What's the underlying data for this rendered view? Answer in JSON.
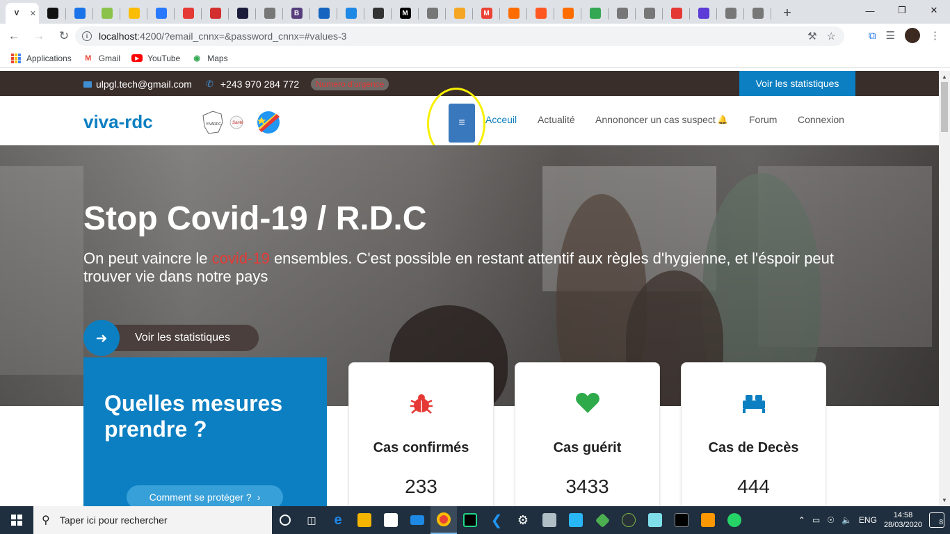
{
  "browser": {
    "tabs": [
      {
        "label": "V",
        "color": "#ffffff",
        "active": true
      },
      {
        "label": "",
        "color": "#111111"
      },
      {
        "label": "",
        "color": "#1a73e8"
      },
      {
        "label": "",
        "color": "#8bc34a"
      },
      {
        "label": "",
        "color": "#fbbc04"
      },
      {
        "label": "",
        "color": "#2979ff"
      },
      {
        "label": "",
        "color": "#e53935"
      },
      {
        "label": "",
        "color": "#d32f2f"
      },
      {
        "label": "",
        "color": "#1b1b3a"
      },
      {
        "label": "",
        "color": "#777777"
      },
      {
        "label": "B",
        "color": "#563d7c"
      },
      {
        "label": "",
        "color": "#1565c0"
      },
      {
        "label": "",
        "color": "#1e88e5"
      },
      {
        "label": "",
        "color": "#333333"
      },
      {
        "label": "M",
        "color": "#000000"
      },
      {
        "label": "",
        "color": "#777777"
      },
      {
        "label": "",
        "color": "#f5a623"
      },
      {
        "label": "M",
        "color": "#ea4335"
      },
      {
        "label": "",
        "color": "#ff6d00"
      },
      {
        "label": "",
        "color": "#ff5722"
      },
      {
        "label": "",
        "color": "#ff6d00"
      },
      {
        "label": "",
        "color": "#34a853"
      },
      {
        "label": "",
        "color": "#777777"
      },
      {
        "label": "",
        "color": "#777777"
      },
      {
        "label": "",
        "color": "#e53935"
      },
      {
        "label": "",
        "color": "#5c3bd6"
      },
      {
        "label": "",
        "color": "#777777"
      },
      {
        "label": "",
        "color": "#777777"
      }
    ],
    "url_host": "localhost",
    "url_rest": ":4200/?email_cnnx=&password_cnnx=#values-3",
    "bookmarks": [
      {
        "label": "Applications",
        "icon": "apps-grid-icon"
      },
      {
        "label": "Gmail",
        "icon": "gmail-icon",
        "color": "#ea4335"
      },
      {
        "label": "YouTube",
        "icon": "youtube-icon",
        "color": "#ff0000"
      },
      {
        "label": "Maps",
        "icon": "maps-icon",
        "color": "#34a853"
      }
    ]
  },
  "site": {
    "topbar": {
      "email": "ulpgl.tech@gmail.com",
      "phone": "+243 970 284 772",
      "urgence": "Numero d'urgence",
      "stats_button": "Voir les statistiques"
    },
    "brand": "viva-rdc",
    "logo_text": "VIVARDC",
    "logo_sante": "Santé",
    "nav": [
      {
        "label": "Acceuil",
        "active": true
      },
      {
        "label": "Actualité"
      },
      {
        "label": "Annononcer un cas suspect",
        "bell": true
      },
      {
        "label": "Forum"
      },
      {
        "label": "Connexion"
      }
    ],
    "hero": {
      "title": "Stop Covid-19 / R.D.C",
      "text_before": "On peut vaincre le ",
      "text_highlight": "covid-19",
      "text_after": " ensembles. C'est possible en restant attentif aux règles d'hygienne, et l'éspoir peut trouver vie dans notre pays",
      "cta": "Voir les statistiques"
    },
    "measures": {
      "title": "Quelles mesures prendre ?",
      "button": "Comment se protéger ?"
    },
    "cards": [
      {
        "label": "Cas confirmés",
        "value": "233",
        "icon": "virus-icon",
        "color": "#e53935"
      },
      {
        "label": "Cas guérit",
        "value": "3433",
        "icon": "heart-icon",
        "color": "#2eaa4a"
      },
      {
        "label": "Cas de Decès",
        "value": "444",
        "icon": "bed-icon",
        "color": "#0b7fc1"
      }
    ]
  },
  "taskbar": {
    "search_placeholder": "Taper ici pour rechercher",
    "lang": "ENG",
    "time": "14:58",
    "date": "28/03/2020",
    "notifications": "8"
  }
}
